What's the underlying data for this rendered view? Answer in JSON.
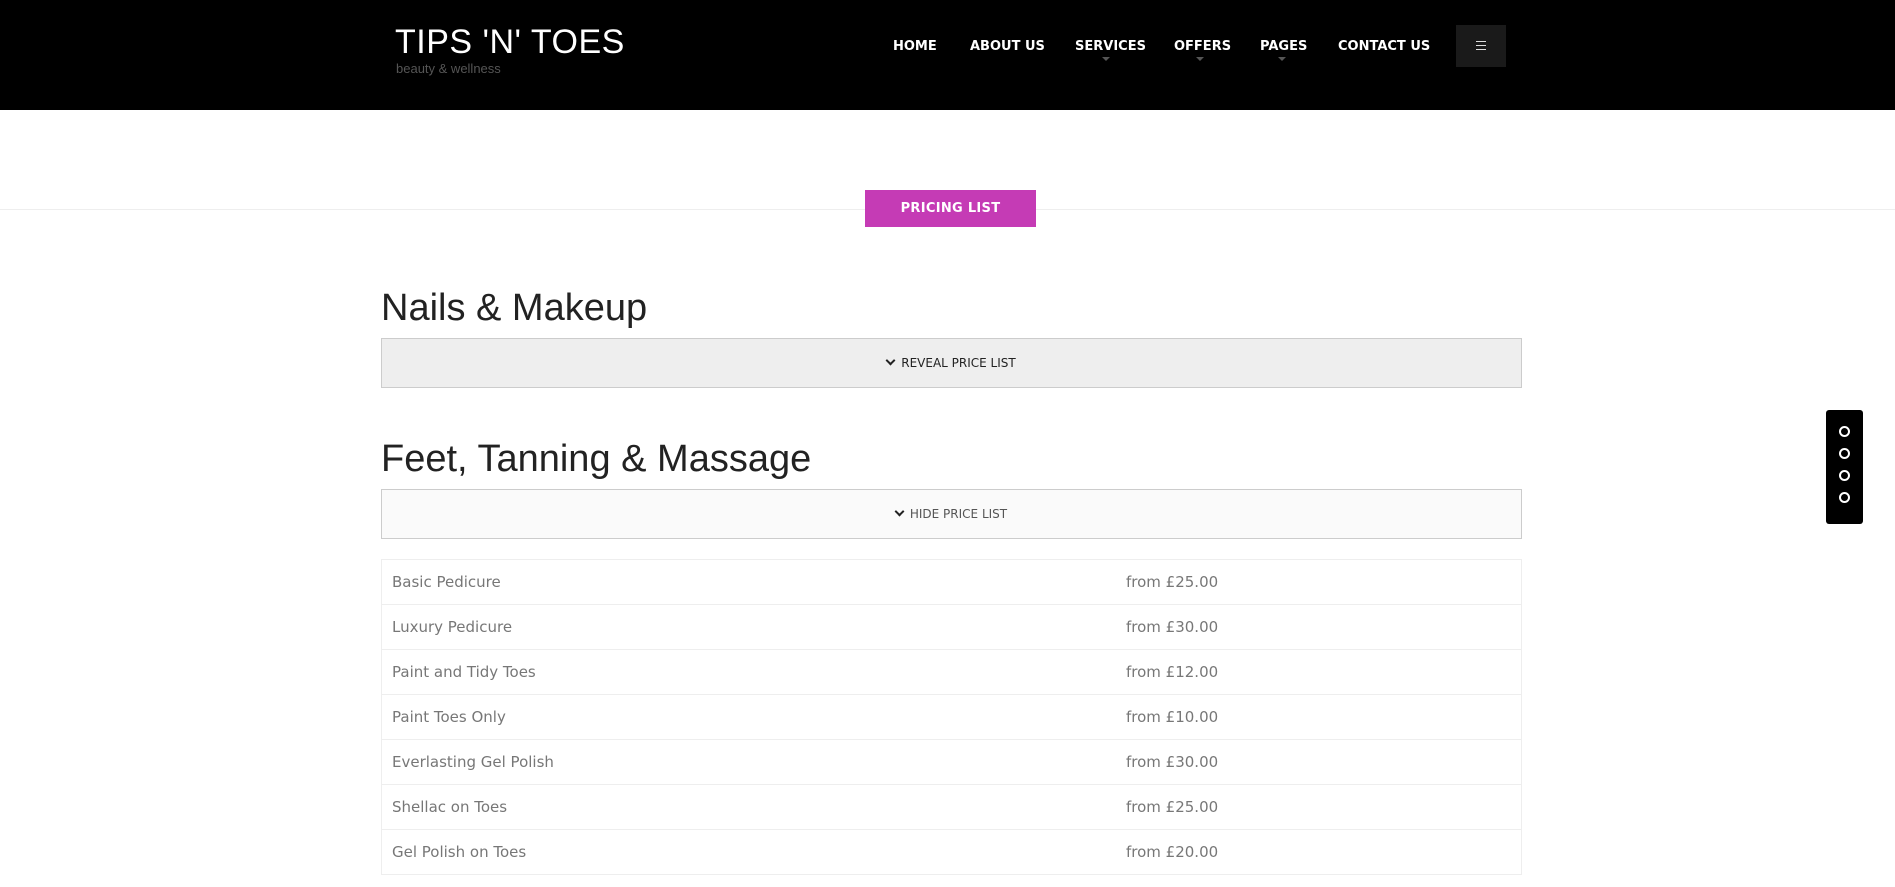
{
  "header": {
    "logo_title": "TIPS 'N' TOES",
    "logo_subtitle": "beauty & wellness",
    "nav": [
      {
        "label": "HOME",
        "has_dropdown": false
      },
      {
        "label": "ABOUT US",
        "has_dropdown": false
      },
      {
        "label": "SERVICES",
        "has_dropdown": true
      },
      {
        "label": "OFFERS",
        "has_dropdown": true
      },
      {
        "label": "PAGES",
        "has_dropdown": true
      },
      {
        "label": "CONTACT US",
        "has_dropdown": false
      }
    ],
    "menu_icon": "hamburger-icon"
  },
  "pricing_label": "PRICING LIST",
  "accent_color": "#c53bb5",
  "sections": [
    {
      "title": "Nails & Makeup",
      "toggle_label": "REVEAL PRICE LIST",
      "expanded": false
    },
    {
      "title": "Feet, Tanning & Massage",
      "toggle_label": "HIDE PRICE LIST",
      "expanded": true,
      "items": [
        {
          "service": "Basic Pedicure",
          "price": "from £25.00"
        },
        {
          "service": "Luxury Pedicure",
          "price": "from £30.00"
        },
        {
          "service": "Paint and Tidy Toes",
          "price": "from £12.00"
        },
        {
          "service": "Paint Toes Only",
          "price": "from £10.00"
        },
        {
          "service": "Everlasting Gel Polish",
          "price": "from £30.00"
        },
        {
          "service": "Shellac on Toes",
          "price": "from £25.00"
        },
        {
          "service": "Gel Polish on Toes",
          "price": "from £20.00"
        }
      ]
    }
  ],
  "side_nav": {
    "dot_count": 4,
    "icon": "circle-outline-icon"
  }
}
